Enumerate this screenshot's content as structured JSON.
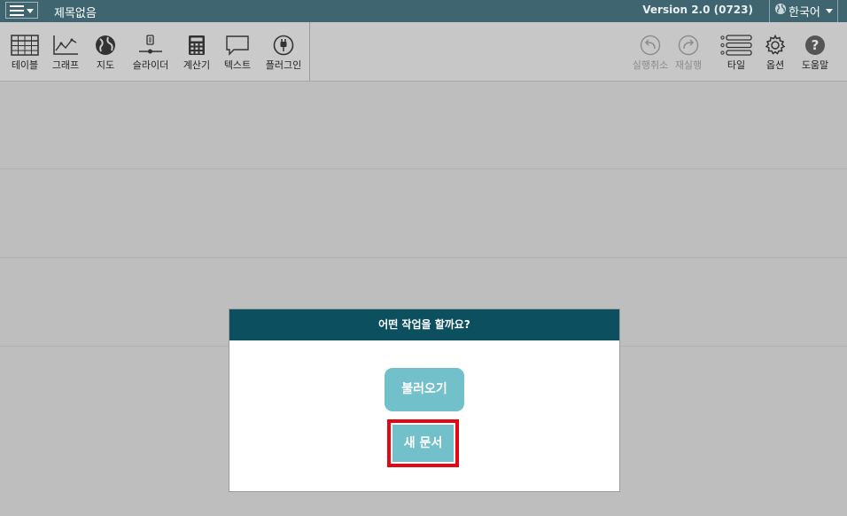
{
  "titlebar": {
    "doc_title": "제목없음",
    "version": "Version 2.0 (0723)",
    "language": "한국어"
  },
  "toolbar": {
    "left_tools": [
      {
        "label": "테이블",
        "icon": "table-icon"
      },
      {
        "label": "그래프",
        "icon": "graph-icon"
      },
      {
        "label": "지도",
        "icon": "globe-icon"
      },
      {
        "label": "슬라이더",
        "icon": "slider-icon"
      },
      {
        "label": "계산기",
        "icon": "calculator-icon"
      },
      {
        "label": "텍스트",
        "icon": "speech-bubble-icon"
      },
      {
        "label": "플러그인",
        "icon": "plug-icon"
      }
    ],
    "right_tools": [
      {
        "label": "실행취소",
        "icon": "undo-icon",
        "enabled": false
      },
      {
        "label": "재실행",
        "icon": "redo-icon",
        "enabled": false
      },
      {
        "label": "타일",
        "icon": "tile-list-icon",
        "enabled": true
      },
      {
        "label": "옵션",
        "icon": "gear-icon",
        "enabled": true
      },
      {
        "label": "도움말",
        "icon": "help-icon",
        "enabled": true
      }
    ]
  },
  "dialog": {
    "title": "어떤 작업을 할까요?",
    "load_label": "불러오기",
    "new_label": "새 문서"
  },
  "colors": {
    "titlebar": "#3f6670",
    "dialog_header": "#0c5060",
    "button": "#72c0c9",
    "highlight": "#e30613"
  }
}
